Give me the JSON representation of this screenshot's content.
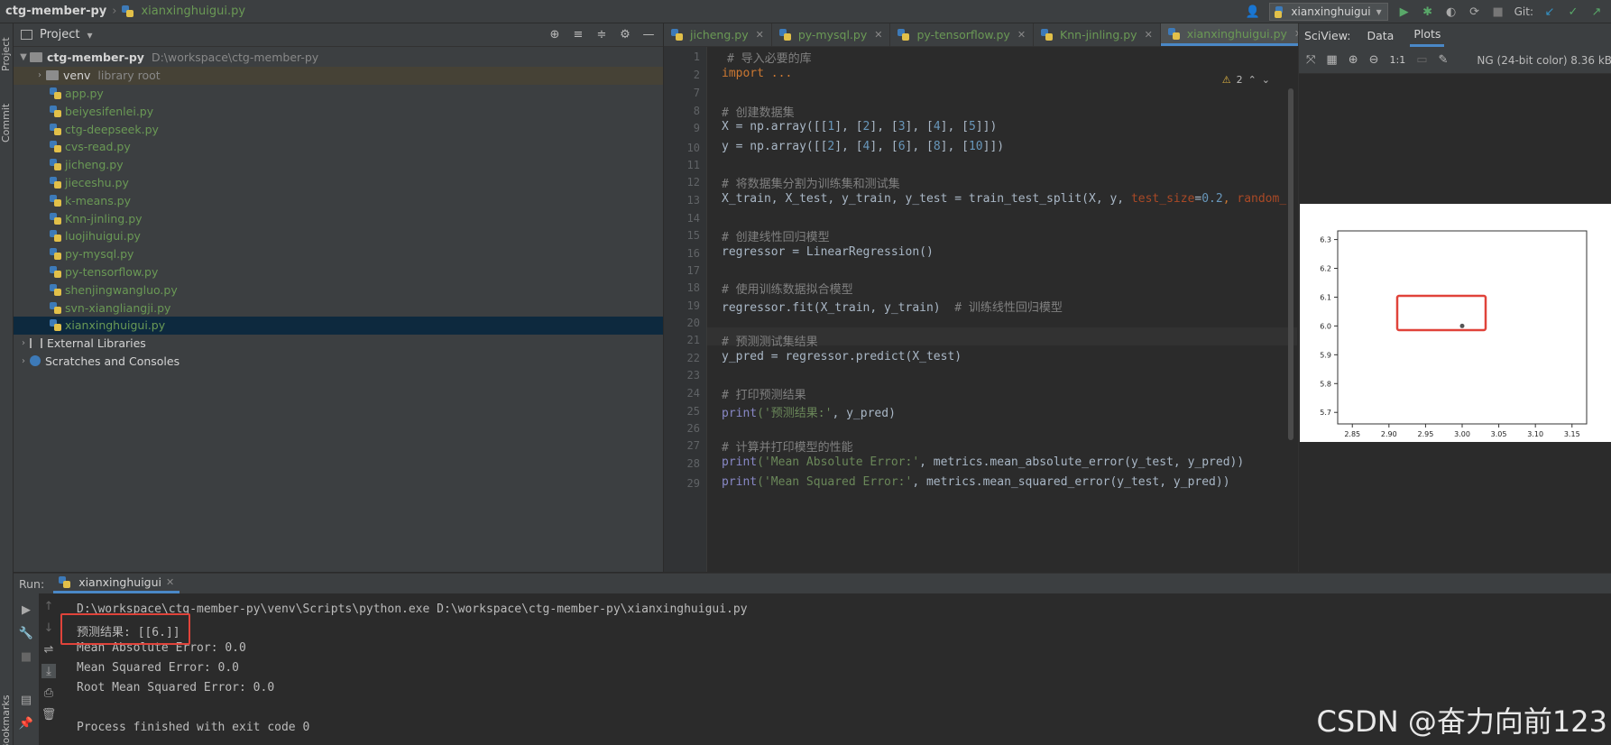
{
  "navbar": {
    "project": "ctg-member-py",
    "file": "xianxinghuigui.py",
    "run_config": "xianxinghuigui",
    "git_label": "Git:"
  },
  "left_strip": {
    "project_tab": "Project",
    "commit_tab": "Commit",
    "bookmarks_tab": "Bookmarks"
  },
  "project_panel": {
    "title": "Project",
    "root": {
      "name": "ctg-member-py",
      "path": "D:\\workspace\\ctg-member-py"
    },
    "venv": {
      "name": "venv",
      "hint": "library root"
    },
    "files": [
      "app.py",
      "beiyesifenlei.py",
      "ctg-deepseek.py",
      "cvs-read.py",
      "jicheng.py",
      "jieceshu.py",
      "k-means.py",
      "Knn-jinling.py",
      "luojihuigui.py",
      "py-mysql.py",
      "py-tensorflow.py",
      "shenjingwangluo.py",
      "svn-xiangliangji.py",
      "xianxinghuigui.py"
    ],
    "external_libraries": "External Libraries",
    "scratches": "Scratches and Consoles"
  },
  "editor": {
    "tabs": [
      "jicheng.py",
      "py-mysql.py",
      "py-tensorflow.py",
      "Knn-jinling.py",
      "xianxinghuigui.py"
    ],
    "active_tab": "xianxinghuigui.py",
    "warning_count": "2",
    "line_numbers": [
      "1",
      "2",
      "7",
      "8",
      "9",
      "10",
      "11",
      "12",
      "13",
      "14",
      "15",
      "16",
      "17",
      "18",
      "19",
      "20",
      "21",
      "22",
      "23",
      "24",
      "25",
      "26",
      "27",
      "28",
      "29"
    ],
    "code": {
      "l1": "# 导入必要的库",
      "l2": "import ...",
      "l8": "# 创建数据集",
      "l9a": "X = np.array([[",
      "l9b": "1",
      "l9c": "], [",
      "l9d": "2",
      "l9e": "], [",
      "l9f": "3",
      "l9g": "], [",
      "l9h": "4",
      "l9i": "], [",
      "l9j": "5",
      "l9k": "]])",
      "l10a": "y = np.array([[",
      "l10b": "2",
      "l10c": "], [",
      "l10d": "4",
      "l10e": "], [",
      "l10f": "6",
      "l10g": "], [",
      "l10h": "8",
      "l10i": "], [",
      "l10j": "10",
      "l10k": "]])",
      "l12": "# 将数据集分割为训练集和测试集",
      "l13a": "X_train, X_test, y_train, y_test = train_test_split(X, y, ",
      "l13b": "test_size",
      "l13c": "=",
      "l13d": "0.2",
      "l13e": ", ",
      "l13f": "random_",
      "l15": "# 创建线性回归模型",
      "l16": "regressor = LinearRegression()",
      "l18": "# 使用训练数据拟合模型",
      "l19a": "regressor.fit(X_train, y_train)  ",
      "l19b": "# 训练线性回归模型",
      "l21": "# 预测测试集结果",
      "l22": "y_pred = regressor.predict(X_test)",
      "l24": "# 打印预测结果",
      "l25a": "print",
      "l25b": "('预测结果:'",
      "l25c": ", y_pred)",
      "l27": "# 计算并打印模型的性能",
      "l28a": "print",
      "l28b": "('Mean Absolute Error:'",
      "l28c": ", metrics.mean_absolute_error(y_test, y_pred))",
      "l29a": "print",
      "l29b": "('Mean Squared Error:'",
      "l29c": ", metrics.mean_squared_error(y_test, y_pred))"
    }
  },
  "sciview": {
    "title": "SciView:",
    "tab_data": "Data",
    "tab_plots": "Plots",
    "zoom_label": "1:1",
    "image_info": "NG (24-bit color) 8.36 kB",
    "plot": {
      "y_ticks": [
        "6.3",
        "6.2",
        "6.1",
        "6.0",
        "5.9",
        "5.8",
        "5.7"
      ],
      "x_ticks": [
        "2.85",
        "2.90",
        "2.95",
        "3.00",
        "3.05",
        "3.10",
        "3.15"
      ]
    }
  },
  "chart_data": {
    "type": "scatter",
    "x": [
      3.0
    ],
    "y": [
      6.0
    ],
    "xlim": [
      2.83,
      3.17
    ],
    "ylim": [
      5.66,
      6.33
    ],
    "x_ticks": [
      2.85,
      2.9,
      2.95,
      3.0,
      3.05,
      3.1,
      3.15
    ],
    "y_ticks": [
      5.7,
      5.8,
      5.9,
      6.0,
      6.1,
      6.2,
      6.3
    ],
    "grid": false,
    "point_color": "#555555"
  },
  "run_panel": {
    "label": "Run:",
    "tab": "xianxinghuigui",
    "output": [
      "D:\\workspace\\ctg-member-py\\venv\\Scripts\\python.exe D:\\workspace\\ctg-member-py\\xianxinghuigui.py",
      "预测结果: [[6.]]",
      "Mean Absolute Error: 0.0",
      "Mean Squared Error: 0.0",
      "Root Mean Squared Error: 0.0",
      "",
      "Process finished with exit code 0"
    ]
  },
  "watermark": "CSDN @奋力向前123",
  "colors": {
    "accent": "#4a88c7",
    "highlight_box": "#e0433a",
    "file_green": "#6a9955"
  }
}
